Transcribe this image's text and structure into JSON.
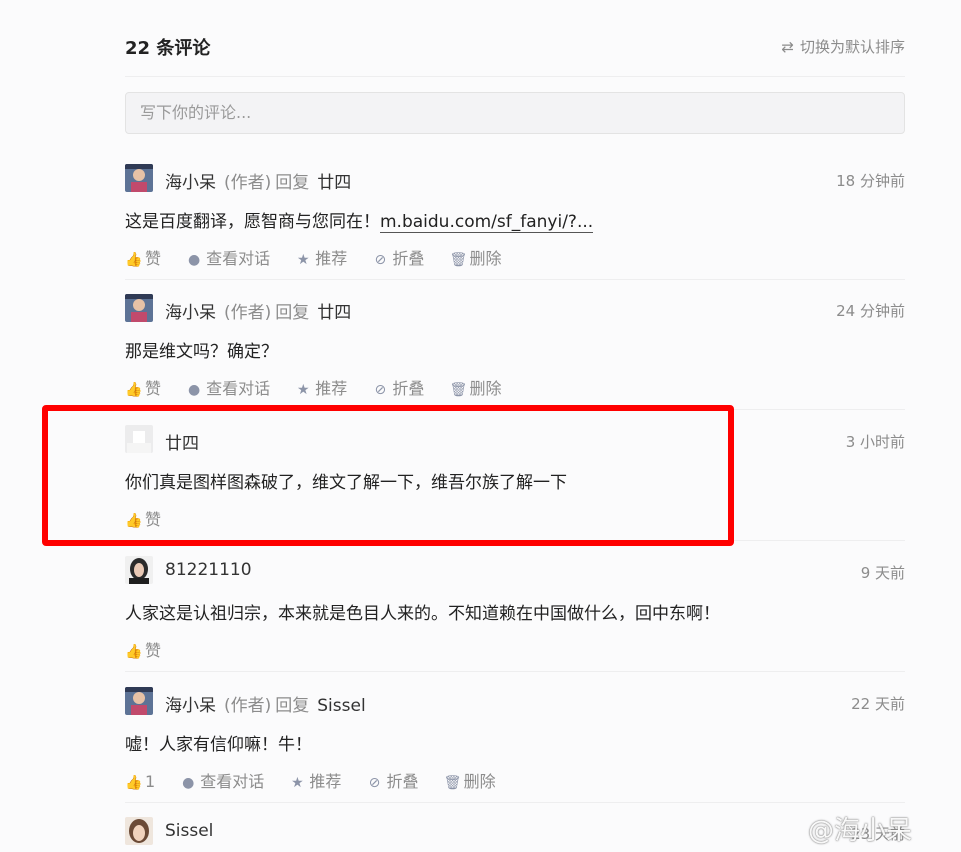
{
  "header": {
    "count_label": "22 条评论",
    "sort_label": "切换为默认排序",
    "sort_icon": "swap-icon"
  },
  "input": {
    "placeholder": "写下你的评论..."
  },
  "comments": [
    {
      "name": "海小呆",
      "author_tag": "(作者)",
      "reply_word": "回复",
      "reply_to": "廿四",
      "time": "18 分钟前",
      "text": "这是百度翻译，愿智商与您同在！",
      "link": "m.baidu.com/sf_fanyi/?...",
      "like": "赞",
      "view": "查看对话",
      "recommend": "推荐",
      "fold": "折叠",
      "delete": "删除",
      "avatar_color": "#6b7fa6"
    },
    {
      "name": "海小呆",
      "author_tag": "(作者)",
      "reply_word": "回复",
      "reply_to": "廿四",
      "time": "24 分钟前",
      "text": "那是维文吗？确定？",
      "like": "赞",
      "view": "查看对话",
      "recommend": "推荐",
      "fold": "折叠",
      "delete": "删除",
      "avatar_color": "#6b7fa6"
    },
    {
      "name": "廿四",
      "time": "3 小时前",
      "text": "你们真是图样图森破了，维文了解一下，维吾尔族了解一下",
      "like": "赞",
      "avatar_color": "#e9e9ea"
    },
    {
      "name": "81221110",
      "time": "9 天前",
      "text": "人家这是认祖归宗，本来就是色目人来的。不知道赖在中国做什么，回中东啊！",
      "like": "赞",
      "avatar_color": "#3b3b3b"
    },
    {
      "name": "海小呆",
      "author_tag": "(作者)",
      "reply_word": "回复",
      "reply_to": "Sissel",
      "time": "22 天前",
      "text": "嘘！人家有信仰嘛！牛！",
      "like": "1",
      "view": "查看对话",
      "recommend": "推荐",
      "fold": "折叠",
      "delete": "删除",
      "avatar_color": "#6b7fa6"
    },
    {
      "name": "Sissel",
      "time": "23 天前",
      "avatar_color": "#c9a58a"
    }
  ],
  "watermark": "@海小呆",
  "colors": {
    "highlight": "#ff0000",
    "muted": "#8c8c8c",
    "icon": "#8c94a8"
  }
}
